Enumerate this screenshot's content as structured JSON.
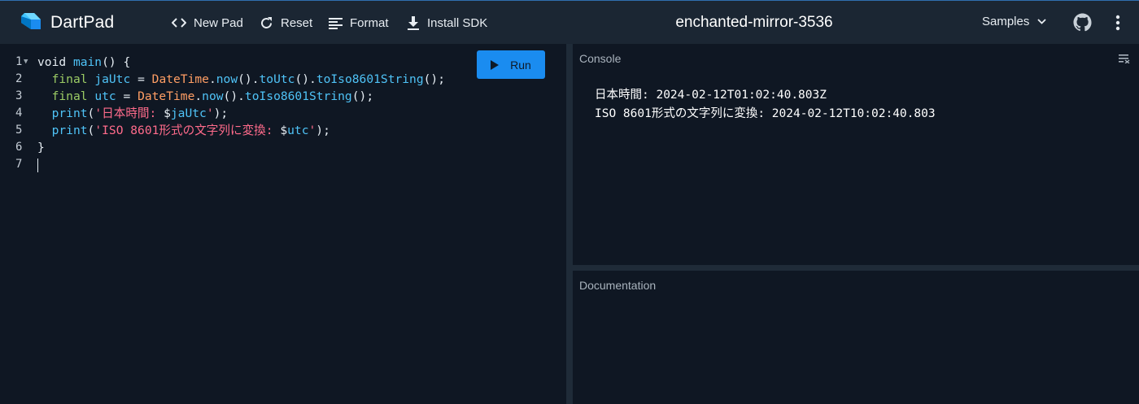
{
  "app": {
    "name": "DartPad"
  },
  "toolbar": {
    "new_pad": "New Pad",
    "reset": "Reset",
    "format": "Format",
    "install_sdk": "Install SDK",
    "samples": "Samples"
  },
  "pad": {
    "title": "enchanted-mirror-3536"
  },
  "editor": {
    "run_label": "Run",
    "line_numbers": [
      "1",
      "2",
      "3",
      "4",
      "5",
      "6",
      "7"
    ],
    "code_lines": [
      "void main() {",
      "  final jaUtc = DateTime.now().toUtc().toIso8601String();",
      "  final utc = DateTime.now().toIso8601String();",
      "  print('日本時間: $jaUtc');",
      "  print('ISO 8601形式の文字列に変換: $utc');",
      "}",
      ""
    ]
  },
  "console": {
    "title": "Console",
    "output": [
      "日本時間: 2024-02-12T01:02:40.803Z",
      "ISO 8601形式の文字列に変換: 2024-02-12T10:02:40.803"
    ]
  },
  "docs": {
    "title": "Documentation"
  },
  "colors": {
    "accent": "#1a8cf0",
    "header_bg": "#1b2633",
    "editor_bg": "#0f1723"
  }
}
